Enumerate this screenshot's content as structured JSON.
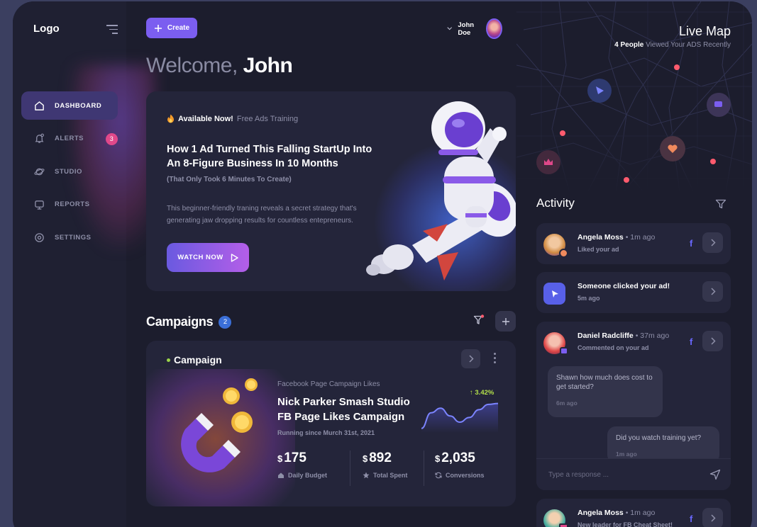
{
  "sidebar": {
    "logo": "Logo",
    "items": [
      {
        "label": "DASHBOARD",
        "icon": "home-icon",
        "active": true
      },
      {
        "label": "ALERTS",
        "icon": "bell-icon",
        "badge": "3"
      },
      {
        "label": "STUDIO",
        "icon": "planet-icon"
      },
      {
        "label": "REPORTS",
        "icon": "reports-icon"
      },
      {
        "label": "SETTINGS",
        "icon": "settings-icon"
      }
    ]
  },
  "header": {
    "create_label": "Create",
    "user_name": "John Doe",
    "welcome_prefix": "Welcome,",
    "welcome_name": "John"
  },
  "hero": {
    "available_label": "Available Now!",
    "available_sub": "Free Ads Training",
    "title": "How 1 Ad Turned This Falling StartUp Into An 8-Figure Business In 10 Months",
    "subtitle": "(That Only Took 6 Minutes To Create)",
    "description": "This beginner-friendly traning reveals a secret strategy that's generating jaw dropping results for countless entepreneurs.",
    "button": "WATCH NOW"
  },
  "campaigns": {
    "title": "Campaigns",
    "count": "2",
    "card": {
      "label": "Campaign",
      "category": "Facebook Page Campaign Likes",
      "title": "Nick Parker Smash Studio FB Page Likes Campaign",
      "since": "Running since Murch 31st, 2021",
      "trend": "3.42%",
      "trend_points": [
        0.95,
        0.45,
        0.3,
        0.55,
        0.75,
        0.6,
        0.35,
        0.18,
        0.15
      ],
      "stats": [
        {
          "currency": "$",
          "value": "175",
          "label": "Daily Budget"
        },
        {
          "currency": "$",
          "value": "892",
          "label": "Total Spent"
        },
        {
          "currency": "$",
          "value": "2,035",
          "label": "Conversions"
        }
      ]
    }
  },
  "map": {
    "title": "Live Map",
    "people": "4 People",
    "sub": "Viewed Your ADS Recently"
  },
  "activity": {
    "title": "Activity",
    "items": [
      {
        "name": "Angela Moss",
        "time": "• 1m ago",
        "action": "Liked your ad"
      },
      {
        "name": "Someone clicked your ad!",
        "time": "",
        "action": "5m ago"
      },
      {
        "name": "Daniel Radcliffe",
        "time": "• 37m ago",
        "action": "Commented on your ad"
      },
      {
        "name": "Angela Moss",
        "time": "• 1m ago",
        "action": "New leader for FB Cheat Sheet!"
      }
    ],
    "chat": [
      {
        "text": "Shawn how much does cost to get started?",
        "time": "6m ago"
      },
      {
        "text": "Did you watch training yet?",
        "time": "1m ago"
      }
    ],
    "reply_placeholder": "Type a response ...",
    "colors": {
      "accent": "#7b5ef0",
      "pin": "#ff5b6e",
      "facebook": "#6a68ff"
    }
  }
}
